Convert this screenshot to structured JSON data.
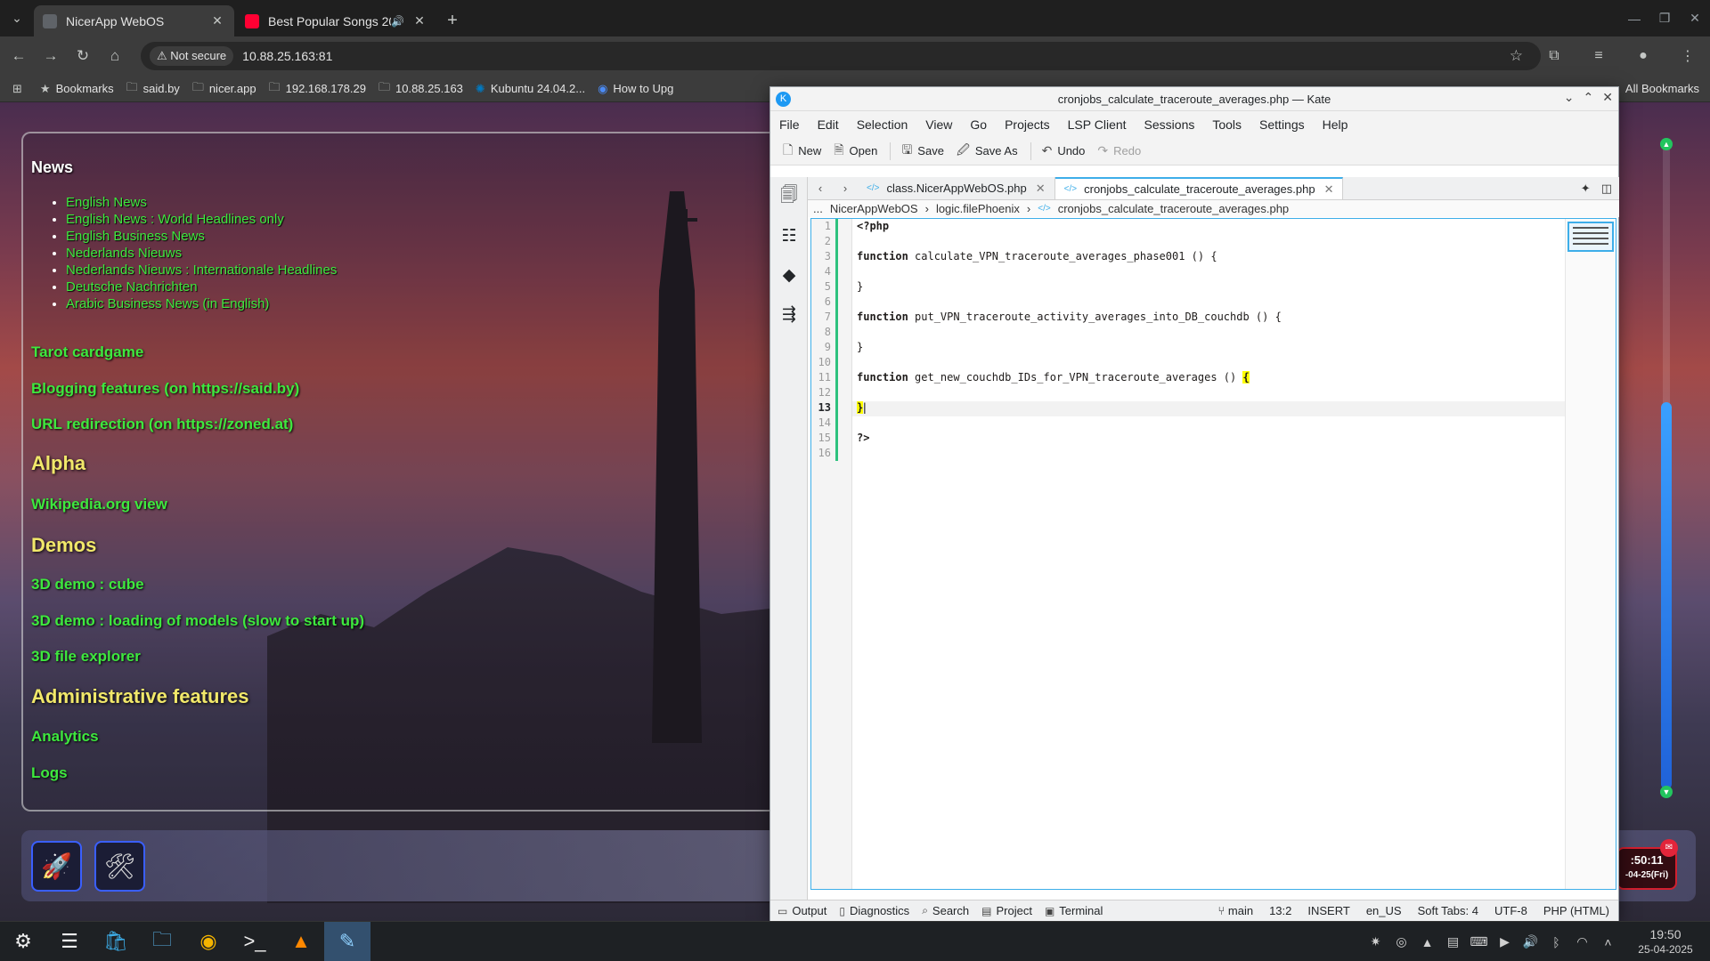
{
  "browser": {
    "tabs": [
      {
        "title": "NicerApp WebOS",
        "active": true,
        "favicon_color": "#5f6368"
      },
      {
        "title": "Best Popular Songs 202",
        "active": false,
        "favicon_color": "#ff0033",
        "playing_audio": true
      }
    ],
    "security_label": "Not secure",
    "url": "10.88.25.163:81",
    "bookmarks": [
      {
        "label": "Bookmarks",
        "icon": "star-icon"
      },
      {
        "label": "said.by",
        "icon": "folder-icon"
      },
      {
        "label": "nicer.app",
        "icon": "folder-icon"
      },
      {
        "label": "192.168.178.29",
        "icon": "folder-icon"
      },
      {
        "label": "10.88.25.163",
        "icon": "folder-icon"
      },
      {
        "label": "Kubuntu 24.04.2...",
        "icon": "kubuntu-icon"
      },
      {
        "label": "How to Upg",
        "icon": "page-icon"
      }
    ],
    "all_bookmarks": "All Bookmarks"
  },
  "site": {
    "news_heading": "News",
    "news_items": [
      "English News",
      "English News : World Headlines only",
      "English Business News",
      "Nederlands Nieuws",
      "Nederlands Nieuws : Internationale Headlines",
      "Deutsche Nachrichten",
      "Arabic Business News (in English)"
    ],
    "menu": [
      {
        "type": "link",
        "label": "Tarot cardgame"
      },
      {
        "type": "link",
        "label": "Blogging features (on https://said.by)"
      },
      {
        "type": "link",
        "label": "URL redirection (on https://zoned.at)"
      },
      {
        "type": "heading",
        "label": "Alpha"
      },
      {
        "type": "link",
        "label": "Wikipedia.org view"
      },
      {
        "type": "heading",
        "label": "Demos"
      },
      {
        "type": "link",
        "label": "3D demo : cube"
      },
      {
        "type": "link",
        "label": "3D demo : loading of models (slow to start up)"
      },
      {
        "type": "link",
        "label": "3D file explorer"
      },
      {
        "type": "heading",
        "label": "Administrative features"
      },
      {
        "type": "link",
        "label": "Analytics"
      },
      {
        "type": "link",
        "label": "Logs"
      }
    ],
    "clock_time": ":50:11",
    "clock_date": "-04-25(Fri)",
    "colors": {
      "link": "#3ee83e",
      "heading": "#f1e86a"
    }
  },
  "kate": {
    "window_title": "cronjobs_calculate_traceroute_averages.php — Kate",
    "menu": [
      "File",
      "Edit",
      "Selection",
      "View",
      "Go",
      "Projects",
      "LSP Client",
      "Sessions",
      "Tools",
      "Settings",
      "Help"
    ],
    "toolbar": {
      "new": "New",
      "open": "Open",
      "save": "Save",
      "save_as": "Save As",
      "undo": "Undo",
      "redo": "Redo"
    },
    "tabs": [
      {
        "label": "class.NicerAppWebOS.php",
        "active": false
      },
      {
        "label": "cronjobs_calculate_traceroute_averages.php",
        "active": true
      }
    ],
    "breadcrumb": [
      "...",
      "NicerAppWebOS",
      "logic.filePhoenix",
      "cronjobs_calculate_traceroute_averages.php"
    ],
    "code_lines": [
      "<?php",
      "",
      "function calculate_VPN_traceroute_averages_phase001 () {",
      "",
      "}",
      "",
      "function put_VPN_traceroute_activity_averages_into_DB_couchdb () {",
      "",
      "}",
      "",
      "function get_new_couchdb_IDs_for_VPN_traceroute_averages () {",
      "",
      "}",
      "",
      "?>",
      ""
    ],
    "current_line": 13,
    "status": {
      "output": "Output",
      "diagnostics": "Diagnostics",
      "search": "Search",
      "project": "Project",
      "terminal": "Terminal",
      "branch": "main",
      "cursor": "13:2",
      "mode": "INSERT",
      "language_locale": "en_US",
      "indent": "Soft Tabs: 4",
      "encoding": "UTF-8",
      "syntax": "PHP (HTML)"
    }
  },
  "taskbar": {
    "time": "19:50",
    "date": "25-04-2025"
  }
}
